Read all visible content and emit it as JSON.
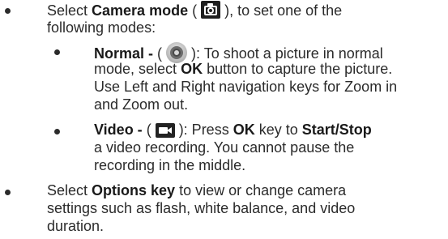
{
  "item1": {
    "line1_pre": "Select ",
    "line1_bold": "Camera mode",
    "line1_mid": " ( ",
    "line1_post": " ), to set one of the",
    "line2": "following modes:"
  },
  "normal": {
    "label": "Normal -",
    "open": " ( ",
    "line1_post": " ): To shoot a picture in normal",
    "line2_pre": "mode, select ",
    "line2_bold": "OK",
    "line2_post": " button to capture the picture.",
    "line3": "Use Left and Right navigation keys for Zoom in",
    "line4": "and Zoom out."
  },
  "video": {
    "label": "Video -",
    "open": " ( ",
    "line1_mid": " ): Press ",
    "line1_ok": "OK",
    "line1_to": " key to ",
    "line1_bold": "Start/Stop",
    "line2": "a video recording. You cannot pause the",
    "line3": "recording in the middle."
  },
  "item2": {
    "line1_pre": "Select ",
    "line1_bold": "Options key",
    "line1_post": " to view or change camera",
    "line2": "settings such as flash, white balance, and video",
    "line3": "duration."
  },
  "icons": [
    "camera-mode-icon",
    "normal-mode-icon",
    "video-mode-icon"
  ],
  "colors": {
    "text": "#2b2b2b",
    "icon_dark": "#1f1f1f"
  }
}
